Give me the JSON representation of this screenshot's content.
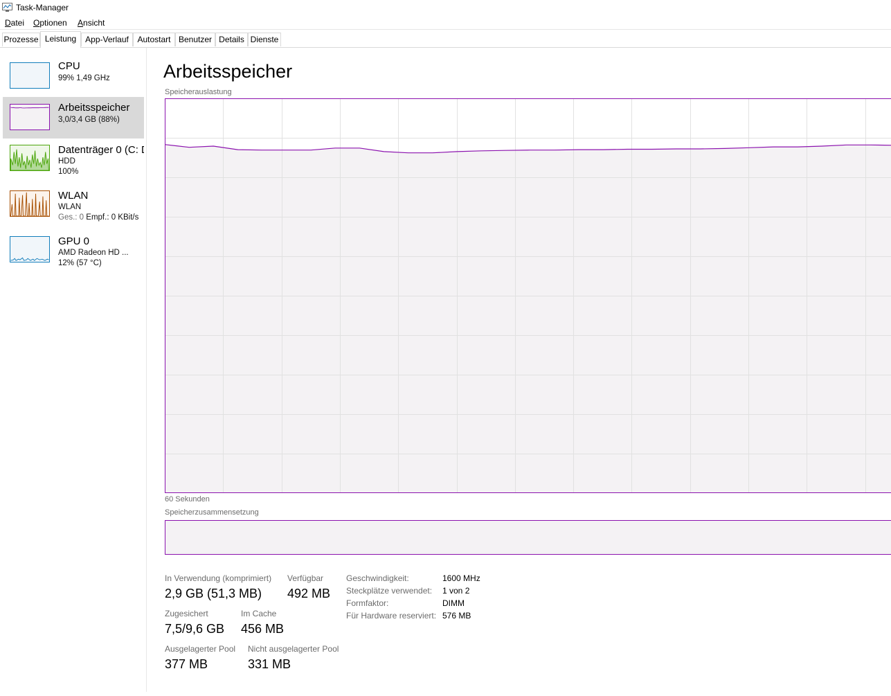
{
  "window": {
    "title": "Task-Manager"
  },
  "menu": [
    {
      "pre": "",
      "u": "D",
      "post": "atei"
    },
    {
      "pre": "",
      "u": "O",
      "post": "ptionen"
    },
    {
      "pre": "",
      "u": "A",
      "post": "nsicht"
    }
  ],
  "tabs": [
    "Prozesse",
    "Leistung",
    "App-Verlauf",
    "Autostart",
    "Benutzer",
    "Details",
    "Dienste"
  ],
  "active_tab": "Leistung",
  "sidebar": {
    "items": [
      {
        "title": "CPU",
        "line1": "99% 1,49 GHz",
        "line2": ""
      },
      {
        "title": "Arbeitsspeicher",
        "line1": "3,0/3,4 GB (88%)",
        "line2": ""
      },
      {
        "title": "Datenträger 0 (C: D",
        "line1": "HDD",
        "line2": "100%"
      },
      {
        "title": "WLAN",
        "line1": "WLAN",
        "line2_a": "Ges.: 0 ",
        "line2_b": "Empf.: 0 KBit/s"
      },
      {
        "title": "GPU 0",
        "line1": "AMD Radeon HD ...",
        "line2": "12% (57 °C)"
      }
    ],
    "colors": {
      "cpu": "#117dbb",
      "memory": "#8b12ae",
      "disk": "#4da60c",
      "wlan": "#a74f01",
      "gpu": "#117dbb"
    }
  },
  "main": {
    "title": "Arbeitsspeicher",
    "usage_label": "Speicherauslastung",
    "time_label": "60 Sekunden",
    "composition_label": "Speicherzusammensetzung"
  },
  "chart_data": {
    "type": "area",
    "title": "Speicherauslastung",
    "xlabel": "60 Sekunden",
    "x": [
      60,
      58,
      56,
      54,
      52,
      50,
      48,
      46,
      44,
      42,
      40,
      38,
      36,
      34,
      32,
      30,
      28,
      26,
      24,
      22,
      20,
      18,
      16,
      14,
      12,
      10,
      8,
      6,
      4,
      2,
      0
    ],
    "values": [
      88.3,
      87.6,
      87.9,
      87.0,
      86.9,
      86.9,
      86.9,
      87.4,
      87.4,
      86.5,
      86.2,
      86.2,
      86.5,
      86.7,
      86.8,
      86.9,
      86.9,
      87.0,
      87.0,
      87.1,
      87.1,
      87.2,
      87.2,
      87.3,
      87.5,
      87.7,
      87.7,
      87.9,
      88.2,
      88.2,
      88.1
    ],
    "ylim": [
      0,
      100
    ],
    "grid": true,
    "color": "#8b12ae",
    "fill": "#f4f2f4"
  },
  "stats": {
    "in_use_label": "In Verwendung (komprimiert)",
    "in_use_value": "2,9 GB (51,3 MB)",
    "available_label": "Verfügbar",
    "available_value": "492 MB",
    "committed_label": "Zugesichert",
    "committed_value": "7,5/9,6 GB",
    "cached_label": "Im Cache",
    "cached_value": "456 MB",
    "paged_label": "Ausgelagerter Pool",
    "paged_value": "377 MB",
    "nonpaged_label": "Nicht ausgelagerter Pool",
    "nonpaged_value": "331 MB"
  },
  "details": [
    {
      "label": "Geschwindigkeit:",
      "value": "1600 MHz"
    },
    {
      "label": "Steckplätze verwendet:",
      "value": "1 von 2"
    },
    {
      "label": "Formfaktor:",
      "value": "DIMM"
    },
    {
      "label": "Für Hardware reserviert:",
      "value": "576 MB"
    }
  ]
}
